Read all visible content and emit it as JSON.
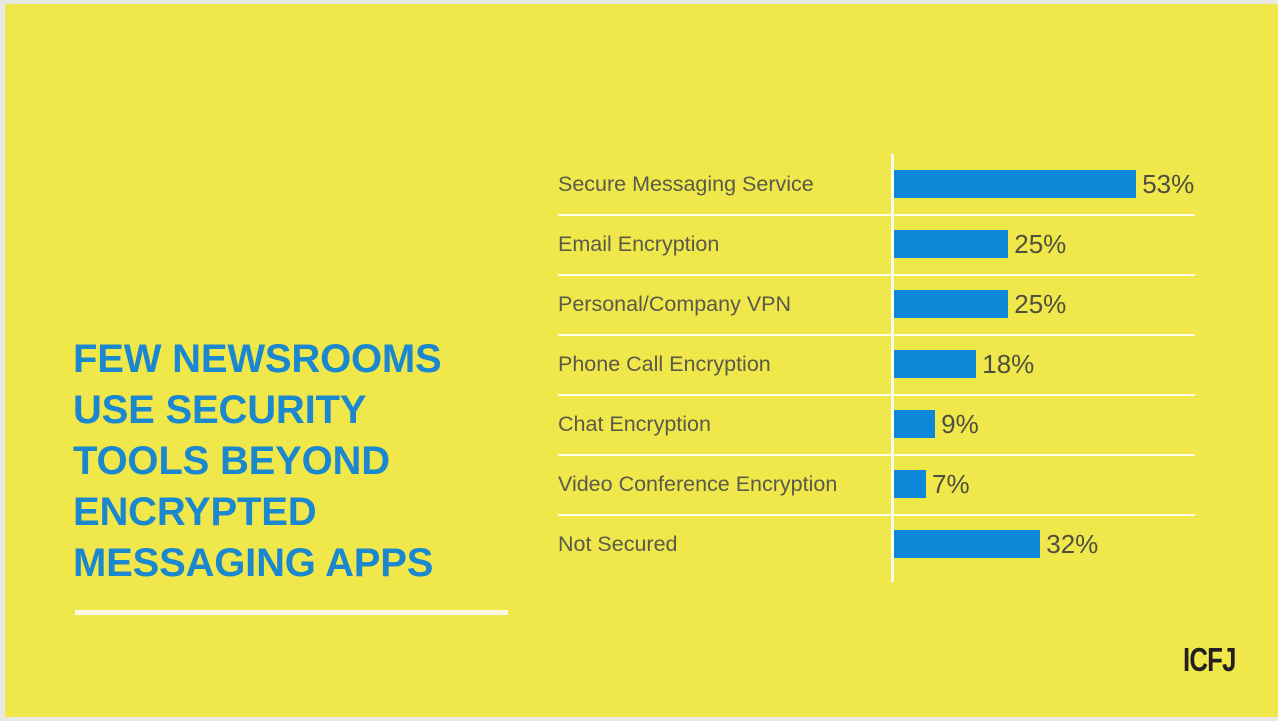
{
  "slide": {
    "background_color": "#f0e84a",
    "accent_color": "#0d87d8",
    "label_color": "#595a4a",
    "rule_color": "#fbf8e3"
  },
  "headline": {
    "text": "FEW NEWSROOMS\nUSE SECURITY\nTOOLS BEYOND\nENCRYPTED\nMESSAGING APPS"
  },
  "logo": {
    "text": "ICFJ"
  },
  "chart_data": {
    "type": "bar",
    "orientation": "horizontal",
    "title": "FEW NEWSROOMS USE SECURITY TOOLS BEYOND ENCRYPTED MESSAGING APPS",
    "xlabel": "",
    "ylabel": "",
    "xlim": [
      0,
      55
    ],
    "grid": true,
    "legend": "none",
    "categories": [
      "Secure Messaging Service",
      "Email Encryption",
      "Personal/Company VPN",
      "Phone Call Encryption",
      "Chat Encryption",
      "Video Conference Encryption",
      "Not Secured"
    ],
    "values": [
      53,
      25,
      25,
      18,
      9,
      7,
      32
    ],
    "value_labels": [
      "53%",
      "25%",
      "25%",
      "18%",
      "9%",
      "7%",
      "32%"
    ],
    "bar_color": "#0d87d8"
  }
}
